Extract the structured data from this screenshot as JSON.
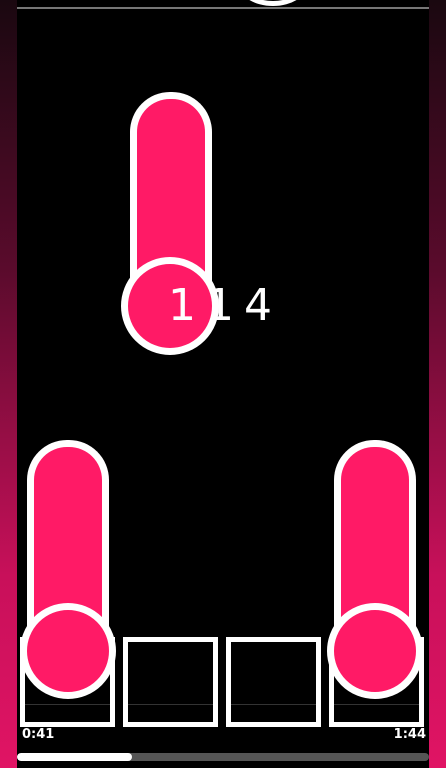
{
  "hud": {
    "combo": "114",
    "time_elapsed": "0:41",
    "time_total": "1:44",
    "progress_fraction": 0.28
  },
  "lanes": [
    "lane-1",
    "lane-2",
    "lane-3",
    "lane-4"
  ],
  "colors": {
    "note_fill": "#ff1a66",
    "note_outline": "#ffffff",
    "side_gradient_top": "#1a0810",
    "side_gradient_bottom": "#e01464"
  },
  "icons": [
    "hold-note",
    "note-head",
    "lane-hit-box"
  ]
}
